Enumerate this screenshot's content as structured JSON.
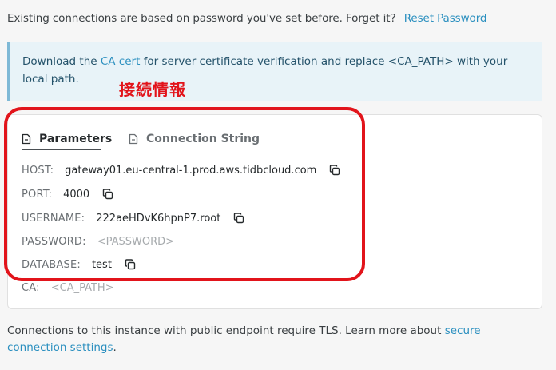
{
  "top_notice": {
    "text": "Existing connections are based on password you've set before. Forget it?",
    "reset_link": "Reset Password"
  },
  "info": {
    "prefix": "Download the ",
    "ca_link": "CA cert",
    "suffix": " for server certificate verification and replace <CA_PATH> with your local path."
  },
  "annotation": "接続情報",
  "tabs": [
    {
      "label": "Parameters",
      "active": true
    },
    {
      "label": "Connection String",
      "active": false
    }
  ],
  "params": {
    "host": {
      "label": "HOST:",
      "value": "gateway01.eu-central-1.prod.aws.tidbcloud.com"
    },
    "port": {
      "label": "PORT:",
      "value": "4000"
    },
    "username": {
      "label": "USERNAME:",
      "value": "222aeHDvK6hpnP7.root"
    },
    "password": {
      "label": "PASSWORD:",
      "value": "<PASSWORD>"
    },
    "database": {
      "label": "DATABASE:",
      "value": "test"
    },
    "ca": {
      "label": "CA:",
      "value": "<CA_PATH>"
    }
  },
  "footer": {
    "prefix": "Connections to this instance with public endpoint require TLS. Learn more about ",
    "link": "secure connection settings",
    "suffix": "."
  },
  "colors": {
    "link": "#2a8fbf",
    "highlight": "#e2141b",
    "info_bg": "#e8f3f8"
  }
}
